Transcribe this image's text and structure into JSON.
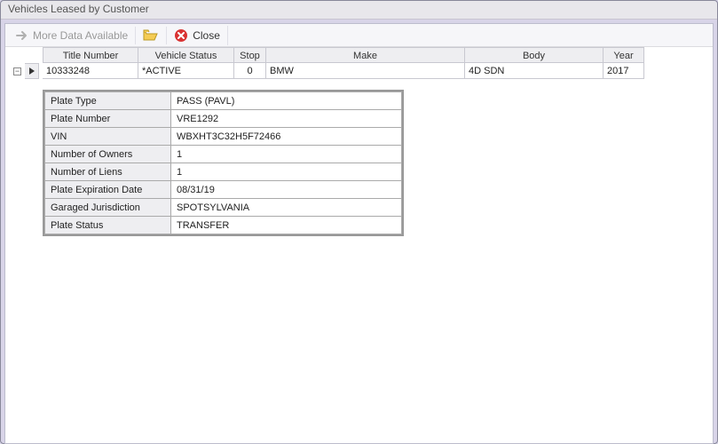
{
  "window": {
    "title": "Vehicles Leased by Customer"
  },
  "toolbar": {
    "more_data_label": "More Data Available",
    "close_label": "Close"
  },
  "grid": {
    "columns": {
      "title_number": "Title Number",
      "vehicle_status": "Vehicle Status",
      "stop": "Stop",
      "make": "Make",
      "body": "Body",
      "year": "Year"
    },
    "rows": [
      {
        "title_number": "10333248",
        "vehicle_status": "*ACTIVE",
        "stop": "0",
        "make": "BMW",
        "body": "4D SDN",
        "year": "2017"
      }
    ],
    "collapse_glyph": "−"
  },
  "details": {
    "rows": [
      {
        "label": "Plate Type",
        "value": "PASS (PAVL)"
      },
      {
        "label": "Plate Number",
        "value": "VRE1292"
      },
      {
        "label": "VIN",
        "value": "WBXHT3C32H5F72466"
      },
      {
        "label": "Number of Owners",
        "value": "1"
      },
      {
        "label": "Number of Liens",
        "value": "1"
      },
      {
        "label": "Plate Expiration Date",
        "value": "08/31/19"
      },
      {
        "label": "Garaged Jurisdiction",
        "value": "SPOTSYLVANIA"
      },
      {
        "label": "Plate Status",
        "value": "TRANSFER"
      }
    ]
  }
}
